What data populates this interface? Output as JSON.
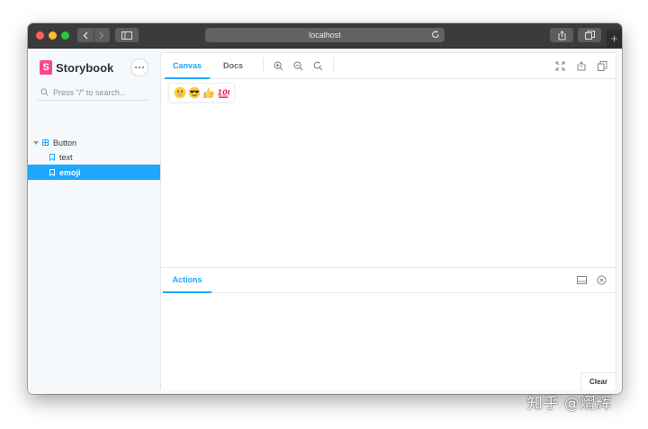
{
  "browser": {
    "address": "localhost",
    "new_tab_label": "+"
  },
  "sidebar": {
    "brand_logo_letter": "S",
    "brand_name": "Storybook",
    "search_placeholder": "Press \"/\" to search...",
    "tree": [
      {
        "label": "Button",
        "type": "component",
        "expanded": true
      },
      {
        "label": "text",
        "type": "story",
        "selected": false
      },
      {
        "label": "emoji",
        "type": "story",
        "selected": true
      }
    ]
  },
  "main": {
    "tabs": [
      {
        "label": "Canvas",
        "active": true
      },
      {
        "label": "Docs",
        "active": false
      }
    ],
    "tools": [
      "zoom-in-icon",
      "zoom-out-icon",
      "zoom-reset-icon"
    ],
    "right_tools": [
      "fullscreen-icon",
      "share-icon",
      "copy-icon"
    ]
  },
  "canvas": {
    "story_button_emojis": [
      "grinning-face",
      "smiling-face-with-sunglasses",
      "thumbs-up",
      "hundred-points"
    ]
  },
  "addons": {
    "tabs": [
      {
        "label": "Actions",
        "active": true
      }
    ],
    "clear_label": "Clear"
  },
  "watermark": "知乎 @熠辉",
  "colors": {
    "accent": "#1ea7fd",
    "brand": "#ff4785",
    "selected_row": "#1ea7fd"
  }
}
